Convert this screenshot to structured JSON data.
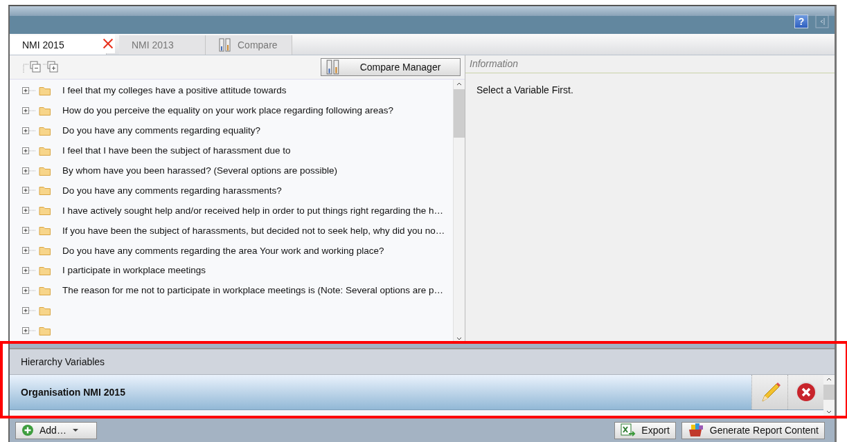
{
  "header": {
    "help_label": "?"
  },
  "tabs": [
    {
      "label": "NMI 2015",
      "selected": true,
      "closable": true,
      "kind": "plain"
    },
    {
      "label": "NMI 2013",
      "selected": false,
      "closable": false,
      "kind": "plain"
    },
    {
      "label": "Compare",
      "selected": false,
      "closable": false,
      "kind": "compare"
    }
  ],
  "compare_manager_button": "Compare Manager",
  "tree": {
    "items": [
      {
        "label": "I feel that my colleges have a positive attitude towards",
        "expanded": false
      },
      {
        "label": "How do you perceive the equality on your work place regarding following areas?",
        "expanded": false
      },
      {
        "label": "Do you have any comments regarding equality?",
        "expanded": false
      },
      {
        "label": "I feel that I have been the subject of harassment due to",
        "expanded": false
      },
      {
        "label": "By whom have you been harassed? (Several options are possible)",
        "expanded": false
      },
      {
        "label": "Do you have any comments regarding harassments?",
        "expanded": false
      },
      {
        "label": "I have actively sought help and/or received help in order to put things right regarding the h…",
        "expanded": false
      },
      {
        "label": "If you have been the subject of harassments, but decided not to seek help, why did you no…",
        "expanded": false
      },
      {
        "label": "Do you have any comments regarding the area Your work and working place?",
        "expanded": false
      },
      {
        "label": "I participate in workplace meetings",
        "expanded": false
      },
      {
        "label": "The reason for me not to participate in workplace meetings is  (Note: Several options are p…",
        "expanded": false
      },
      {
        "expanded": false
      },
      {
        "expanded": false
      }
    ]
  },
  "information": {
    "title": "Information",
    "message": "Select a Variable First."
  },
  "hierarchy": {
    "title": "Hierarchy Variables",
    "items": [
      {
        "label": "Organisation NMI 2015",
        "selected": true
      }
    ]
  },
  "footer": {
    "add_button": "Add…",
    "export_button": "Export",
    "generate_button": "Generate Report Content"
  }
}
